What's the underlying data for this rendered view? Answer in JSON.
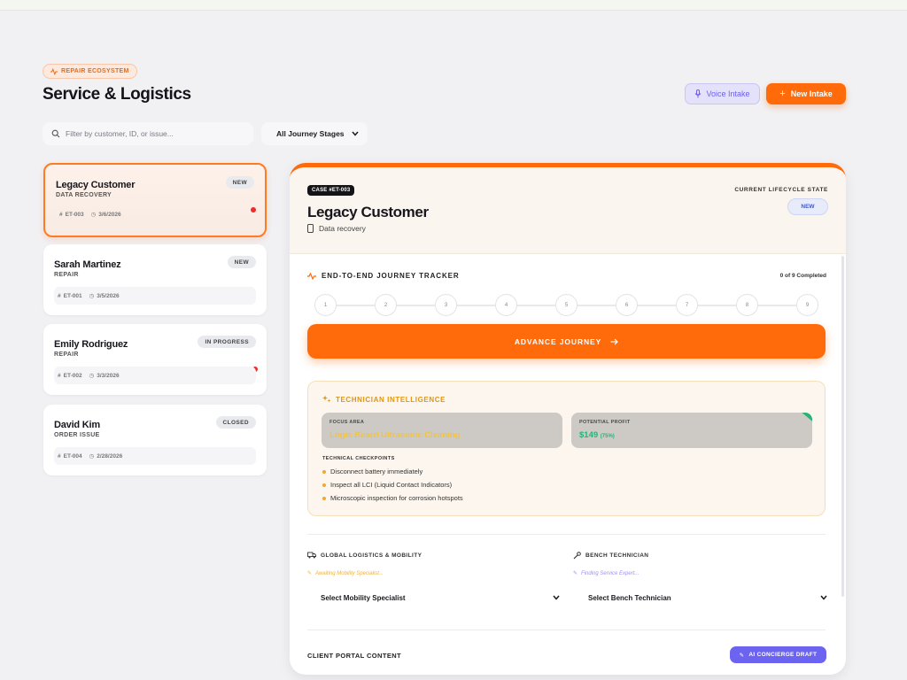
{
  "header": {
    "eyebrow": "REPAIR ECOSYSTEM",
    "title": "Service & Logistics",
    "voice_button": "Voice Intake",
    "new_button": "New Intake"
  },
  "filters": {
    "search_placeholder": "Filter by customer, ID, or issue...",
    "stage_select": "All Journey Stages"
  },
  "cases": [
    {
      "name": "Legacy Customer",
      "type": "DATA RECOVERY",
      "status": "NEW",
      "id": "ET-003",
      "date": "3/6/2026",
      "alert": true,
      "active": true
    },
    {
      "name": "Sarah Martinez",
      "type": "REPAIR",
      "status": "NEW",
      "id": "ET-001",
      "date": "3/5/2026",
      "alert": false,
      "active": false
    },
    {
      "name": "Emily Rodriguez",
      "type": "REPAIR",
      "status": "IN PROGRESS",
      "id": "ET-002",
      "date": "3/3/2026",
      "alert": true,
      "active": false
    },
    {
      "name": "David Kim",
      "type": "ORDER ISSUE",
      "status": "CLOSED",
      "id": "ET-004",
      "date": "2/28/2026",
      "alert": false,
      "active": false
    }
  ],
  "detail": {
    "case_tag": "CASE #ET-003",
    "title": "Legacy Customer",
    "subtitle": "Data recovery",
    "lifecycle_label": "CURRENT LIFECYCLE STATE",
    "lifecycle_state": "NEW",
    "tracker": {
      "title": "END-TO-END JOURNEY TRACKER",
      "count": "0 of 9 Completed",
      "steps": [
        "1",
        "2",
        "3",
        "4",
        "5",
        "6",
        "7",
        "8",
        "9"
      ],
      "advance_label": "ADVANCE JOURNEY"
    },
    "intel": {
      "title": "TECHNICIAN INTELLIGENCE",
      "focus_label": "FOCUS AREA",
      "focus_value": "Logic Board Ultrasonic Cleaning",
      "profit_label": "POTENTIAL PROFIT",
      "profit_value": "$149",
      "profit_pct": "(75%)",
      "checks_title": "TECHNICAL CHECKPOINTS",
      "checks": [
        "Disconnect battery immediately",
        "Inspect all LCI (Liquid Contact Indicators)",
        "Microscopic inspection for corrosion hotspots"
      ]
    },
    "logistics": {
      "title": "GLOBAL LOGISTICS & MOBILITY",
      "note": "Awaiting Mobility Specialist...",
      "select": "Select Mobility Specialist"
    },
    "bench": {
      "title": "BENCH TECHNICIAN",
      "note": "Finding Service Expert...",
      "select": "Select Bench Technician"
    },
    "portal_title": "CLIENT PORTAL CONTENT",
    "ai_button": "AI CONCIERGE DRAFT"
  },
  "colors": {
    "accent": "#ff6a0a",
    "violet": "#6c63f0",
    "amber": "#e2960d",
    "success": "#22b573",
    "alert": "#ef2a2a"
  }
}
